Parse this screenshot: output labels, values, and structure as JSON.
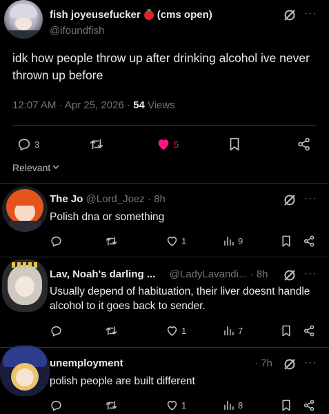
{
  "main_post": {
    "display_name": "fish joyeusefucker",
    "name_suffix": "(cms open)",
    "handle": "@ifoundfish",
    "text": "idk how people throw up after drinking alcohol ive never thrown up before",
    "timestamp": "12:07 AM · Apr 25, 2026 ·",
    "views_count": "54",
    "views_label": "Views",
    "reply_count": "3",
    "like_count": "5",
    "like_color": "#f91880"
  },
  "sort_label": "Relevant",
  "replies": [
    {
      "display_name": "The Jo",
      "handle": "@Lord_Joez",
      "time": "· 8h",
      "text": "Polish dna or something",
      "like_count": "1",
      "view_count": "9"
    },
    {
      "display_name": "Lav, Noah's darling ...",
      "handle": "@LadyLavandi...",
      "time": "· 8h",
      "text": "Usually depend of habituation, their liver doesnt handle alcohol to it goes back to sender.",
      "like_count": "1",
      "view_count": "7"
    },
    {
      "display_name": "unemployment",
      "handle": "",
      "time": "· 7h",
      "text": "polish people are built different",
      "like_count": "1",
      "view_count": "8"
    }
  ],
  "icons": {
    "reply": "reply-icon",
    "retweet": "retweet-icon",
    "like": "heart-icon",
    "views": "views-icon",
    "bookmark": "bookmark-icon",
    "share": "share-icon",
    "grok": "grok-icon",
    "more": "more-icon",
    "tomato": "tomato-emoji-icon"
  }
}
